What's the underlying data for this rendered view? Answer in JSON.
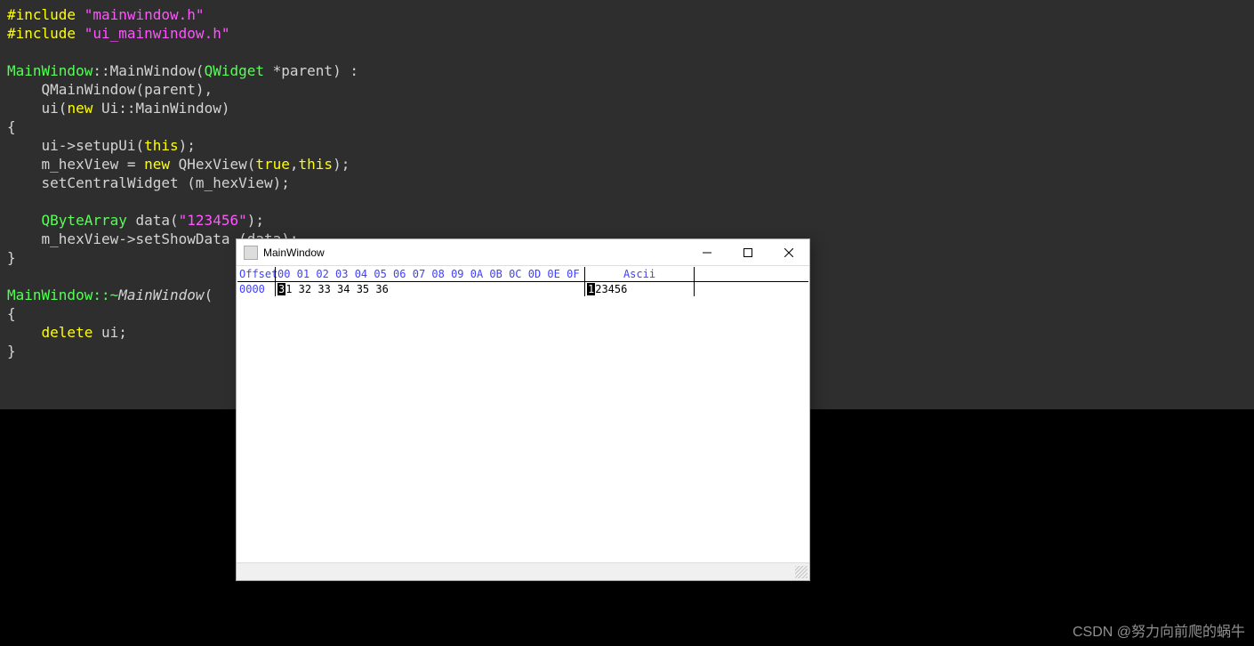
{
  "code": {
    "lines": [
      {
        "t": "preproc",
        "pre": "#include",
        "str": "\"mainwindow.h\""
      },
      {
        "t": "preproc",
        "pre": "#include",
        "str": "\"ui_mainwindow.h\""
      },
      {
        "t": "blank"
      },
      {
        "t": "ctor",
        "a": "MainWindow",
        "b": "::MainWindow(",
        "c": "QWidget",
        "d": " *parent) :"
      },
      {
        "t": "plain",
        "indent": "    ",
        "content": "QMainWindow(parent),"
      },
      {
        "t": "uinew",
        "indent": "    ",
        "a": "ui(",
        "k": "new",
        "b": " Ui::MainWindow)"
      },
      {
        "t": "plain",
        "content": "{"
      },
      {
        "t": "this",
        "indent": "    ",
        "a": "ui->setupUi(",
        "k": "this",
        "b": ");"
      },
      {
        "t": "hex",
        "indent": "    ",
        "a": "m_hexView = ",
        "k1": "new",
        "b": " QHexView(",
        "k2": "true",
        "c": ",",
        "k3": "this",
        "d": ");"
      },
      {
        "t": "plain",
        "indent": "    ",
        "content": "setCentralWidget (m_hexView);"
      },
      {
        "t": "blank"
      },
      {
        "t": "data",
        "indent": "    ",
        "a": "QByteArray",
        " b": " data(",
        "s": "\"123456\"",
        "c": ");",
        " _b": " data("
      },
      {
        "t": "plain",
        "indent": "    ",
        "content": "m_hexView->setShowData (data);"
      },
      {
        "t": "plain",
        "content": "}"
      },
      {
        "t": "blank"
      },
      {
        "t": "dtor",
        "a": "MainWindow::~",
        "b": "MainWindow",
        "c": "("
      },
      {
        "t": "plain",
        "content": "{"
      },
      {
        "t": "delete",
        "indent": "    ",
        "k": "delete",
        "b": " ui;"
      },
      {
        "t": "plain",
        "content": "}"
      }
    ]
  },
  "window": {
    "title": "MainWindow",
    "hex": {
      "header_offset": "Offset",
      "header_bytes": " 00 01 02 03 04 05 06 07 08 09 0A 0B 0C 0D 0E 0F",
      "header_ascii": "Ascii",
      "rows": [
        {
          "offset": " 0000",
          "bytes_cursor": "3",
          "bytes_rest": "1 32 33 34 35 36",
          "ascii_cursor": "1",
          "ascii_rest": "23456"
        }
      ]
    }
  },
  "watermark": "CSDN @努力向前爬的蜗牛"
}
